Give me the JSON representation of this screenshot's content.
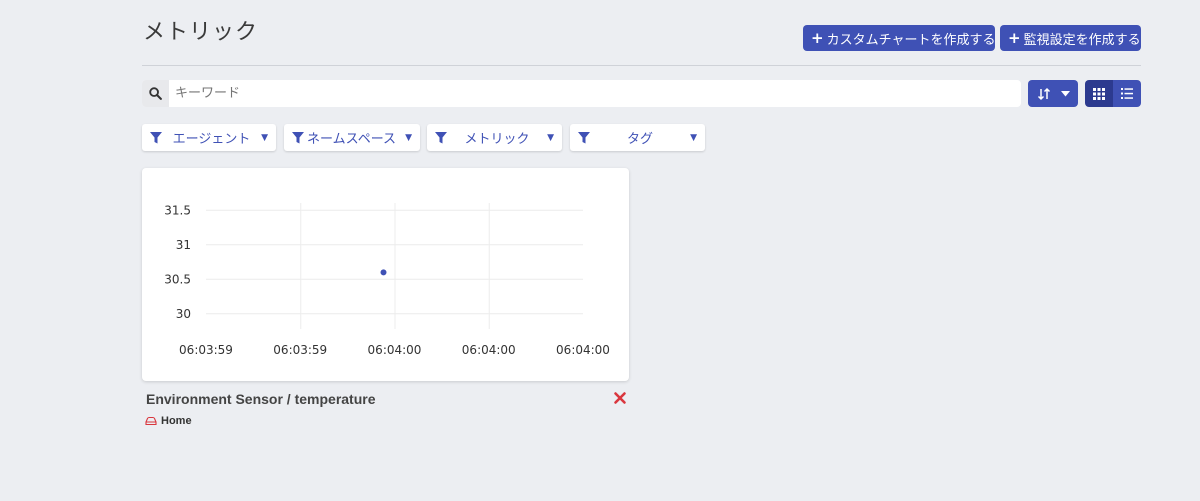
{
  "page": {
    "title": "メトリック"
  },
  "header": {
    "create_custom_chart": "カスタムチャートを作成する",
    "create_monitor": "監視設定を作成する"
  },
  "search": {
    "value": "キーワード"
  },
  "filters": [
    {
      "label": "エージェント"
    },
    {
      "label": "ネームスペース"
    },
    {
      "label": "メトリック"
    },
    {
      "label": "タグ"
    }
  ],
  "cards": [
    {
      "title": "Environment Sensor / temperature",
      "tag": "Home",
      "chart_data": {
        "type": "scatter",
        "x": [
          "06:03:59",
          "06:03:59",
          "06:04:00",
          "06:04:00",
          "06:04:00"
        ],
        "y_ticks": [
          30,
          30.5,
          31,
          31.5
        ],
        "points": [
          {
            "x": "06:04:00",
            "y": 30.6
          }
        ],
        "ylim": [
          29.75,
          31.75
        ],
        "title": "",
        "xlabel": "",
        "ylabel": "",
        "grid": true,
        "point_color": "#3f51b5"
      }
    }
  ],
  "colors": {
    "primary": "#3f51b5",
    "primary_dark": "#2c3a8f",
    "danger": "#d9363e",
    "background": "#eceef2"
  },
  "icons": {
    "add": "plus-icon",
    "search": "search-icon",
    "sort": "sort-icon",
    "grid": "grid-view-icon",
    "list": "list-view-icon",
    "filter": "filter-icon",
    "remove": "close-icon",
    "tag": "car-icon"
  }
}
